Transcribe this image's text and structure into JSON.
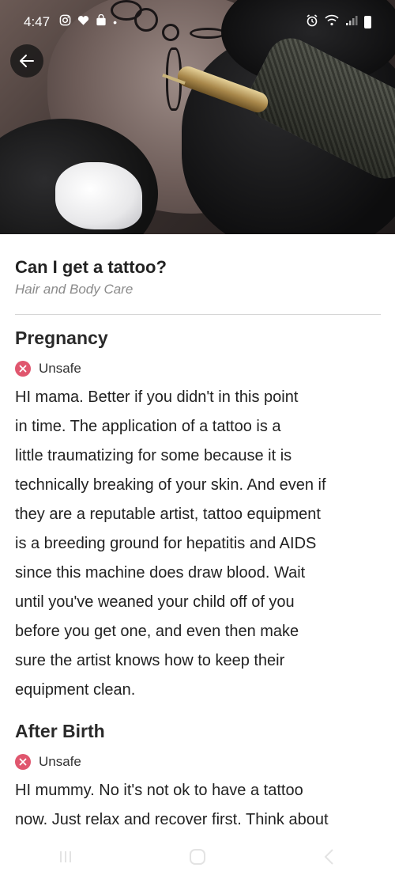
{
  "status_bar": {
    "time": "4:47",
    "left_icons": [
      "instagram-icon",
      "heart-icon",
      "shopping-bag-icon"
    ],
    "right_icons": [
      "alarm-icon",
      "wifi-icon",
      "signal-icon",
      "battery-icon"
    ]
  },
  "hero": {
    "description_icon": "tattoo-photo"
  },
  "header": {
    "title": "Can I get a tattoo?",
    "category": "Hair and Body Care"
  },
  "sections": [
    {
      "title": "Pregnancy",
      "status": "Unsafe",
      "status_color": "#e0566e",
      "lines": [
        "HI mama. Better if you didn't in this point",
        "in time. The application of a tattoo is a",
        "little traumatizing for some because it is",
        "technically breaking of your skin. And even if",
        "they are a reputable artist, tattoo equipment",
        "is a breeding ground for hepatitis and AIDS",
        "since this machine does draw blood. Wait",
        "until you've weaned your child off of you",
        "before you get one, and even then make",
        "sure the artist knows how to keep their",
        "equipment clean."
      ]
    },
    {
      "title": "After Birth",
      "status": "Unsafe",
      "status_color": "#e0566e",
      "lines": [
        "HI mummy. No it's not ok to have a tattoo",
        "now. Just relax and recover first. Think about"
      ]
    }
  ],
  "nav": {
    "icons": [
      "recent-apps-icon",
      "home-icon",
      "back-nav-icon"
    ]
  }
}
